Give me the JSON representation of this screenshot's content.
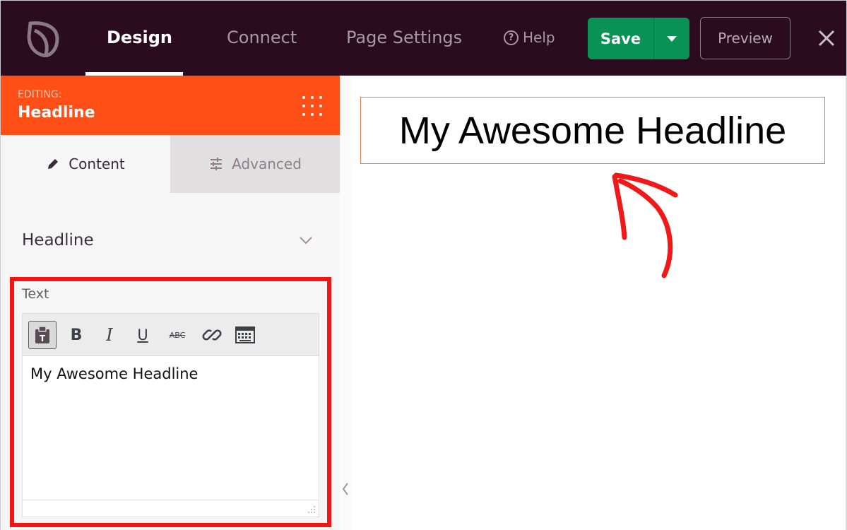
{
  "topbar": {
    "logo_icon": "seedprod-leaf-icon",
    "tabs": [
      {
        "label": "Design",
        "active": true
      },
      {
        "label": "Connect",
        "active": false
      },
      {
        "label": "Page Settings",
        "active": false
      }
    ],
    "help_label": "Help",
    "save_label": "Save",
    "preview_label": "Preview",
    "colors": {
      "background": "#2b0b1e",
      "save": "#099255"
    }
  },
  "sidebar": {
    "editing_label": "EDITING:",
    "editing_title": "Headline",
    "editing_color": "#ff4f17",
    "tabs": [
      {
        "label": "Content",
        "icon": "pencil-icon",
        "active": true
      },
      {
        "label": "Advanced",
        "icon": "sliders-icon",
        "active": false
      }
    ],
    "section_title": "Headline",
    "text_label": "Text",
    "toolbar": [
      "paste-text-icon",
      "bold-icon",
      "italic-icon",
      "underline-icon",
      "strikethrough-icon",
      "link-icon",
      "keyboard-icon"
    ],
    "toolbar_glyphs": {
      "bold": "B",
      "italic": "I",
      "underline": "U",
      "strike": "ABC"
    },
    "editor_value": "My Awesome Headline",
    "highlight_color": "#ef1616"
  },
  "canvas": {
    "headline": "My Awesome Headline",
    "annotation": "red-arrow-icon"
  }
}
